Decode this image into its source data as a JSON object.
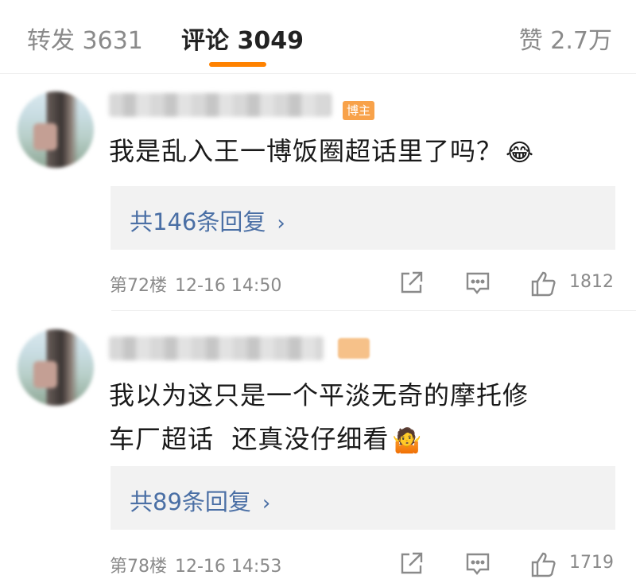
{
  "tabs": {
    "repost": "转发 3631",
    "comment": "评论 3049",
    "like": "赞 2.7万"
  },
  "comments": [
    {
      "badge": "博主",
      "text": "我是乱入王一博饭圈超话里了吗？",
      "emoji": "😂",
      "replies": "共146条回复",
      "floor": "第72楼",
      "time": "12-16 14:50",
      "likes": "1812"
    },
    {
      "text_line1": "我以为这只是一个平淡无奇的摩托修",
      "text_line2": "车厂超话  还真没仔细看",
      "emoji": "🤷",
      "replies": "共89条回复",
      "floor": "第78楼",
      "time": "12-16 14:53",
      "likes": "1719"
    }
  ],
  "icons": {
    "chevron": "›",
    "share": "share-icon",
    "comment": "comment-icon",
    "like": "thumbs-up-icon"
  },
  "colors": {
    "accent": "#ff8200",
    "link": "#4a6fa5",
    "badge": "#f8a24a"
  }
}
